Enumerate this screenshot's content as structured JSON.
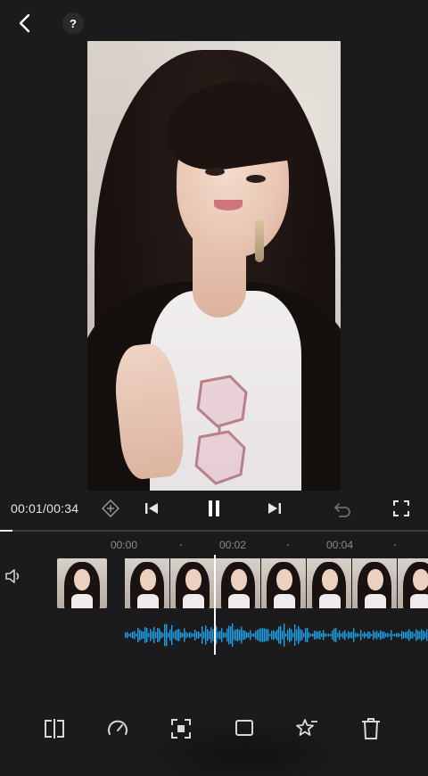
{
  "header": {
    "back_icon": "chevron-left-icon",
    "help_label": "?"
  },
  "player": {
    "time_current": "00:01",
    "time_separator": "/",
    "time_total": "00:34",
    "progress": 0.03,
    "icons": {
      "keyframe": "keyframe-diamond-icon",
      "prev": "skip-previous-icon",
      "play": "pause-icon",
      "next": "skip-next-icon",
      "undo": "undo-icon",
      "fullscreen": "fullscreen-icon"
    }
  },
  "timeline": {
    "ruler": [
      "00:00",
      "00:02",
      "00:04"
    ],
    "mute_icon": "speaker-icon",
    "clip_count": 7
  },
  "toolbar": {
    "icons": [
      "split-icon",
      "speed-icon",
      "crop-icon",
      "replace-icon",
      "effects-icon",
      "delete-icon"
    ]
  },
  "colors": {
    "background": "#1b1b1d",
    "waveform": "#1da1e6",
    "playhead": "#ffffff"
  }
}
